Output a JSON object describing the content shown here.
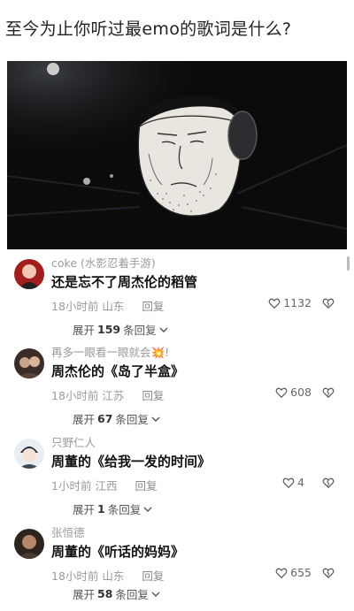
{
  "post": {
    "title": "至今为止你听过最emo的歌词是什么?"
  },
  "comments": [
    {
      "user": "coke",
      "user_tag": "(水影忍着手游)",
      "text": "还是忘不了周杰伦的稻管",
      "time": "18小时前",
      "location": "山东",
      "reply_label": "回复",
      "likes": "1132",
      "expand_prefix": "展开",
      "expand_count": "159",
      "expand_suffix": "条回复"
    },
    {
      "user": "再多一眼看一眼就会💥!",
      "user_tag": "",
      "text": "周杰伦的《岛了半盒》",
      "time": "18小时前",
      "location": "江苏",
      "reply_label": "回复",
      "likes": "608",
      "expand_prefix": "展开",
      "expand_count": "67",
      "expand_suffix": "条回复"
    },
    {
      "user": "只野仁人",
      "user_tag": "",
      "text": "周董的《给我一发的时间》",
      "time": "1小时前",
      "location": "江西",
      "reply_label": "回复",
      "likes": "4",
      "expand_prefix": "展开",
      "expand_count": "1",
      "expand_suffix": "条回复"
    },
    {
      "user": "张恒德",
      "user_tag": "",
      "text": "周董的《听话的妈妈》",
      "time": "18小时前",
      "location": "山东",
      "reply_label": "回复",
      "likes": "655",
      "expand_prefix": "展开",
      "expand_count": "58",
      "expand_suffix": "条回复"
    }
  ],
  "icons": {
    "like": "heart-outline-icon",
    "dislike": "broken-heart-icon",
    "expand": "chevron-down-icon"
  },
  "colors": {
    "meta_gray": "#9b9b9b",
    "video_bg": "#0b0b0c"
  }
}
